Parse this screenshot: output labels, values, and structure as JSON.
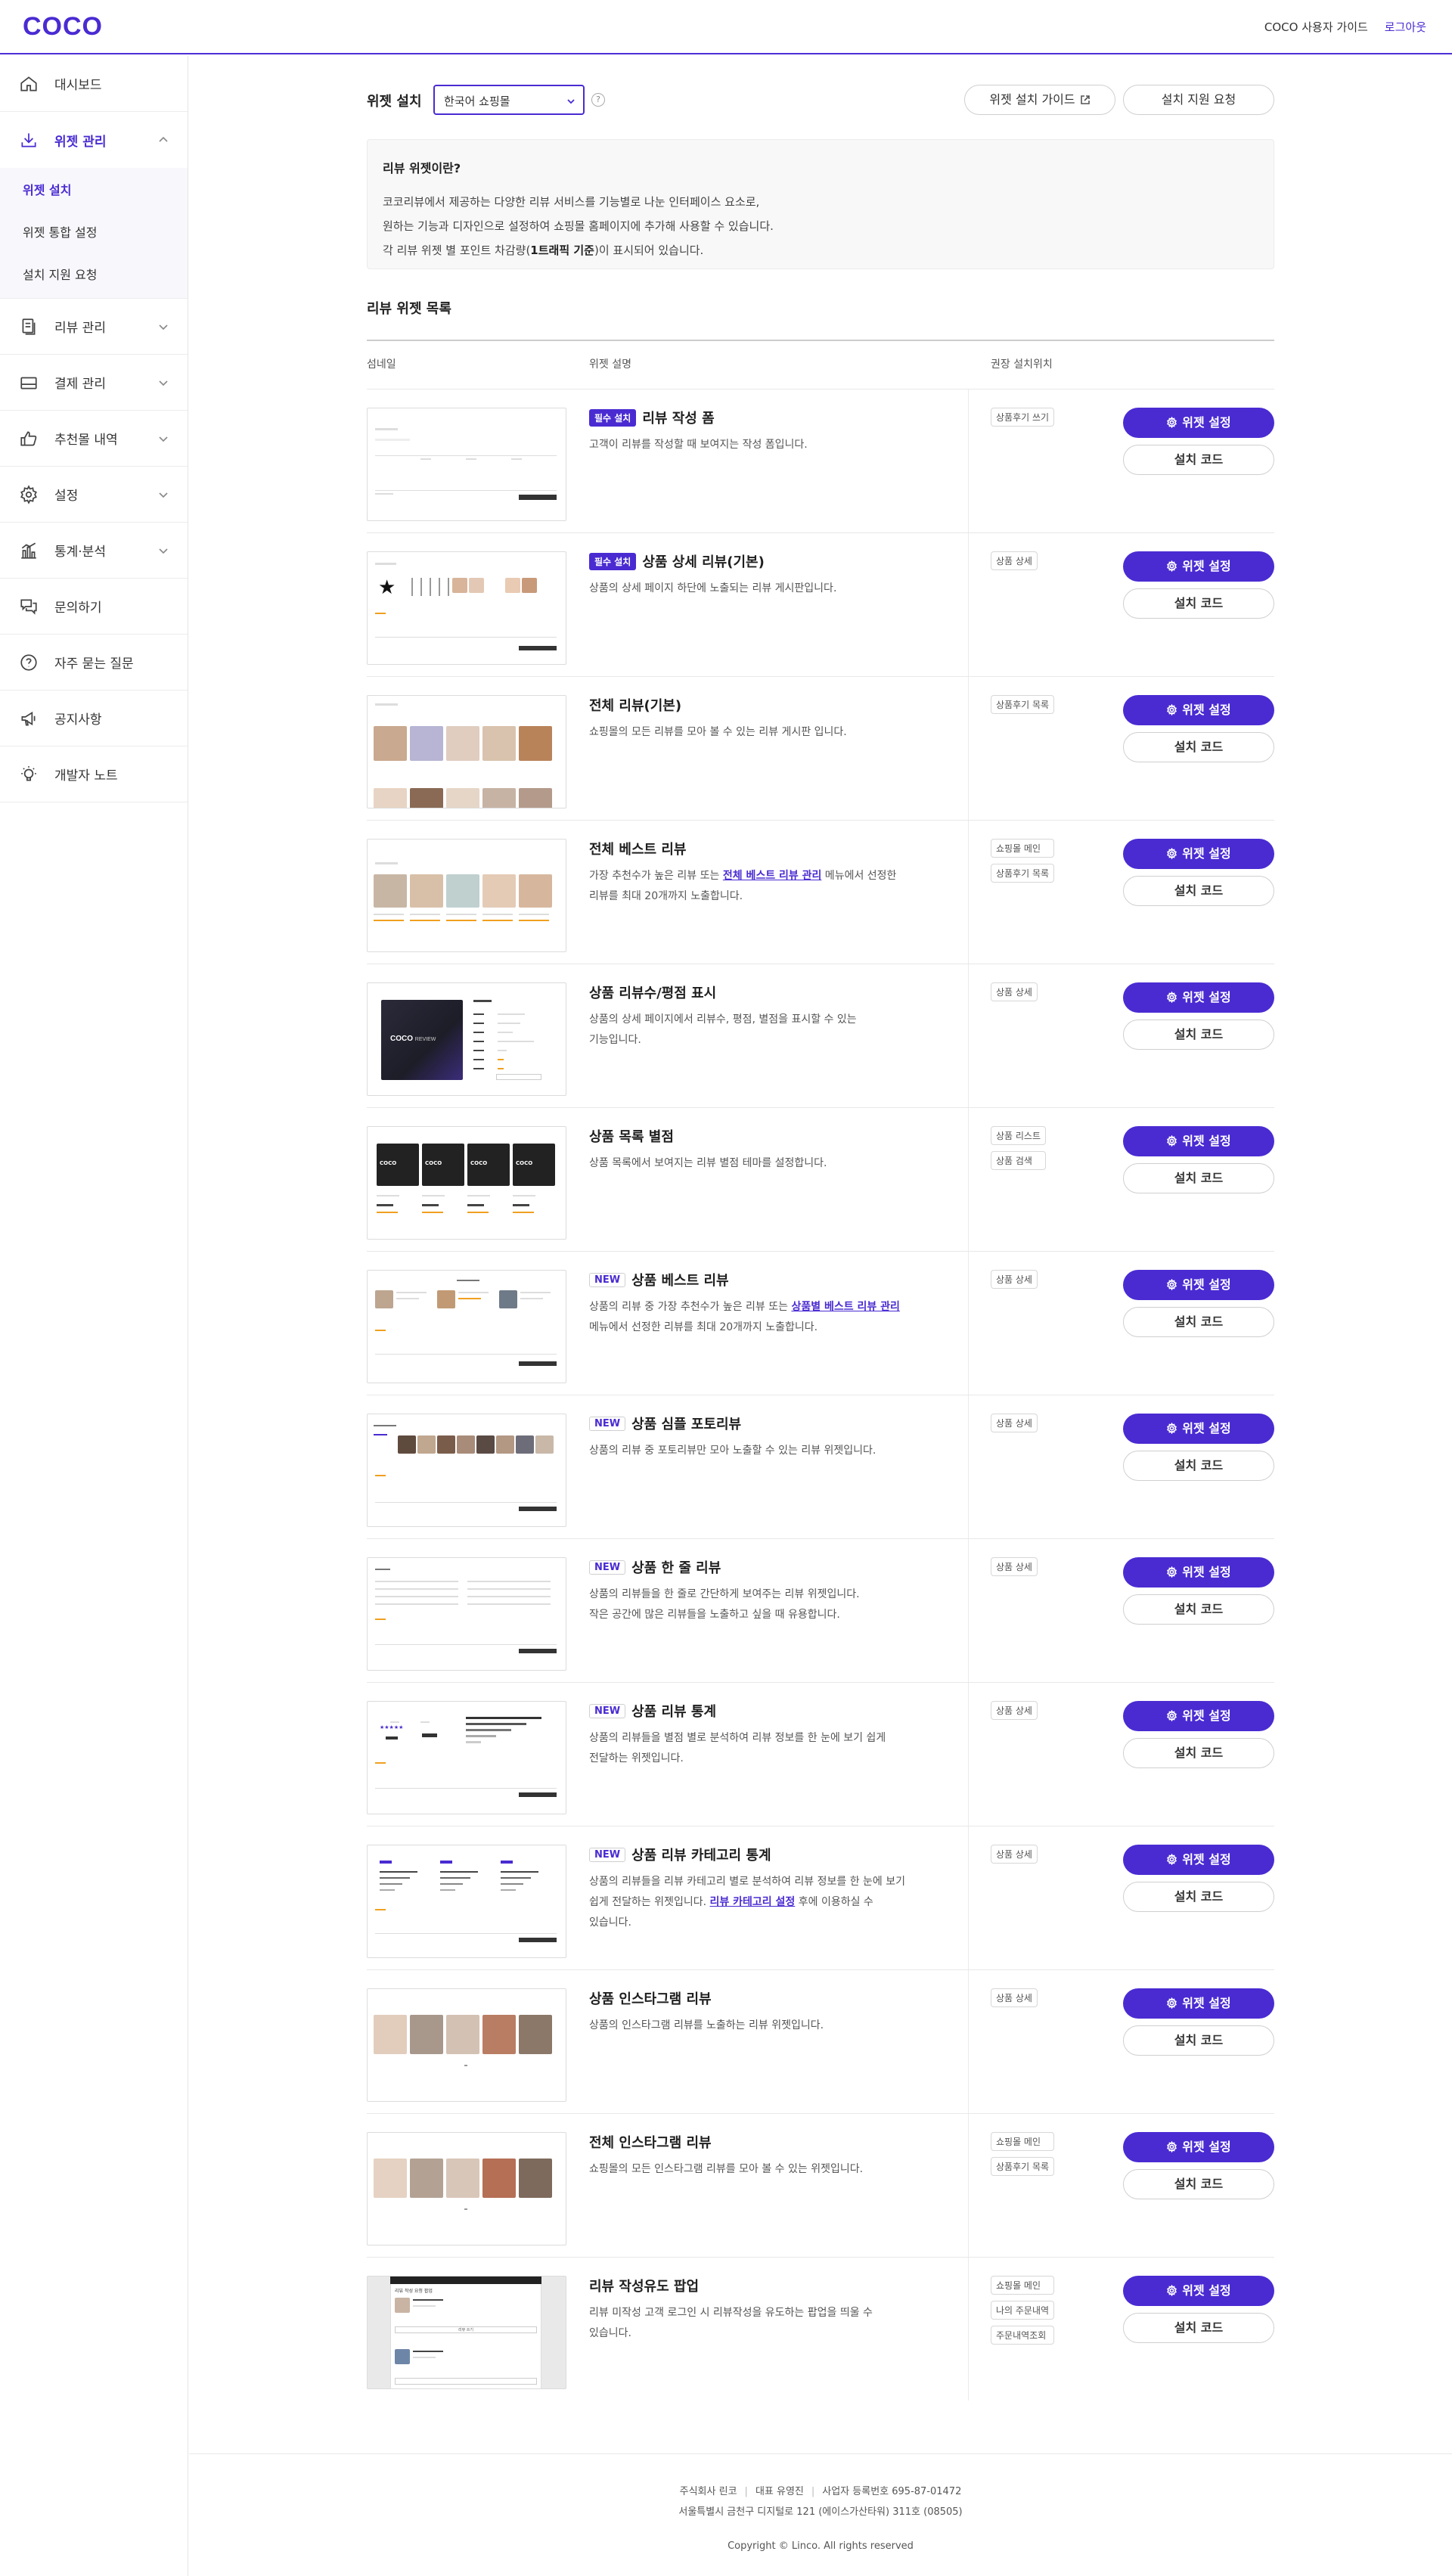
{
  "header": {
    "logo": "COCO",
    "guide_link": "COCO 사용자 가이드",
    "logout_link": "로그아웃"
  },
  "sidebar": {
    "items": [
      {
        "label": "대시보드",
        "icon": "home-icon"
      },
      {
        "label": "위젯 관리",
        "icon": "download-icon",
        "active": true
      },
      {
        "label": "리뷰 관리",
        "icon": "document-icon"
      },
      {
        "label": "결제 관리",
        "icon": "card-icon"
      },
      {
        "label": "추천몰 내역",
        "icon": "thumbs-up-icon"
      },
      {
        "label": "설정",
        "icon": "gear-icon"
      },
      {
        "label": "통계·분석",
        "icon": "chart-icon"
      },
      {
        "label": "문의하기",
        "icon": "chat-icon"
      },
      {
        "label": "자주 묻는 질문",
        "icon": "question-icon"
      },
      {
        "label": "공지사항",
        "icon": "megaphone-icon"
      },
      {
        "label": "개발자 노트",
        "icon": "bulb-icon"
      }
    ],
    "submenu": [
      "위젯 설치",
      "위젯 통합 설정",
      "설치 지원 요청"
    ]
  },
  "topbar": {
    "label": "위젯 설치",
    "select_value": "한국어 쇼핑몰",
    "help": "?",
    "guide_button": "위젯 설치 가이드",
    "support_button": "설치 지원 요청"
  },
  "info": {
    "title": "리뷰 위젯이란?",
    "line1": "코코리뷰에서 제공하는 다양한 리뷰 서비스를 기능별로 나눈 인터페이스 요소로,",
    "line2": "원하는 기능과 디자인으로 설정하여 쇼핑몰 홈페이지에 추가해 사용할 수 있습니다.",
    "line3_pre": "각 리뷰 위젯 별 포인트 차감량(",
    "line3_bold": "1트래픽 기준",
    "line3_post": ")이 표시되어 있습니다."
  },
  "list": {
    "title": "리뷰 위젯 목록",
    "col_thumb": "섬네일",
    "col_desc": "위젯 설명",
    "col_loc": "권장 설치위치",
    "setting_button": "위젯 설정",
    "code_button": "설치 코드",
    "badge_required": "필수 설치",
    "badge_new": "NEW"
  },
  "widgets": [
    {
      "title": "리뷰 작성 폼",
      "badge": "required",
      "desc": [
        "고객이 리뷰를 작성할 때 보여지는 작성 폼입니다."
      ],
      "locations": [
        "상품후기 쓰기"
      ]
    },
    {
      "title": "상품 상세 리뷰(기본)",
      "badge": "required",
      "desc": [
        "상품의 상세 페이지 하단에 노출되는 리뷰 게시판입니다."
      ],
      "locations": [
        "상품 상세"
      ]
    },
    {
      "title": "전체 리뷰(기본)",
      "badge": "",
      "desc": [
        "쇼핑몰의 모든 리뷰를 모아 볼 수 있는 리뷰 게시판 입니다."
      ],
      "locations": [
        "상품후기 목록"
      ]
    },
    {
      "title": "전체 베스트 리뷰",
      "badge": "",
      "desc_pre": "가장 추천수가 높은 리뷰 또는 ",
      "desc_link": "전체 베스트 리뷰 관리",
      "desc_post": " 메뉴에서 선정한",
      "desc2": "리뷰를 최대 20개까지 노출합니다.",
      "locations": [
        "쇼핑몰 메인",
        "상품후기 목록"
      ]
    },
    {
      "title": "상품 리뷰수/평점 표시",
      "badge": "",
      "desc": [
        "상품의 상세 페이지에서 리뷰수, 평점, 별점을 표시할 수 있는",
        "기능입니다."
      ],
      "locations": [
        "상품 상세"
      ]
    },
    {
      "title": "상품 목록 별점",
      "badge": "",
      "desc": [
        "상품 목록에서 보여지는 리뷰 별점 테마를 설정합니다."
      ],
      "locations": [
        "상품 리스트",
        "상품 검색"
      ]
    },
    {
      "title": "상품 베스트 리뷰",
      "badge": "new",
      "desc_pre": "상품의 리뷰 중 가장 추천수가 높은 리뷰 또는 ",
      "desc_link": "상품별 베스트 리뷰 관리",
      "desc_post": "",
      "desc2": "메뉴에서 선정한 리뷰를 최대 20개까지 노출합니다.",
      "locations": [
        "상품 상세"
      ]
    },
    {
      "title": "상품 심플 포토리뷰",
      "badge": "new",
      "desc": [
        "상품의 리뷰 중 포토리뷰만 모아 노출할 수 있는 리뷰 위젯입니다."
      ],
      "locations": [
        "상품 상세"
      ]
    },
    {
      "title": "상품 한 줄 리뷰",
      "badge": "new",
      "desc": [
        "상품의 리뷰들을 한 줄로 간단하게 보여주는 리뷰 위젯입니다.",
        "작은 공간에 많은 리뷰들을 노출하고 싶을 때 유용합니다."
      ],
      "locations": [
        "상품 상세"
      ]
    },
    {
      "title": "상품 리뷰 통계",
      "badge": "new",
      "desc": [
        "상품의 리뷰들을 별점 별로 분석하여 리뷰 정보를 한 눈에 보기 쉽게",
        "전달하는 위젯입니다."
      ],
      "locations": [
        "상품 상세"
      ]
    },
    {
      "title": "상품 리뷰 카테고리 통계",
      "badge": "new",
      "desc_a": "상품의 리뷰들을 리뷰 카테고리 별로 분석하여 리뷰 정보를 한 눈에 보기",
      "desc_b_pre": "쉽게 전달하는 위젯입니다. ",
      "desc_link": "리뷰 카테고리 설정",
      "desc_b_post": " 후에 이용하실 수",
      "desc_c": "있습니다.",
      "locations": [
        "상품 상세"
      ]
    },
    {
      "title": "상품 인스타그램 리뷰",
      "badge": "",
      "desc": [
        "상품의 인스타그램 리뷰를 노출하는 리뷰 위젯입니다."
      ],
      "locations": [
        "상품 상세"
      ]
    },
    {
      "title": "전체 인스타그램 리뷰",
      "badge": "",
      "desc": [
        "쇼핑몰의 모든 인스타그램 리뷰를 모아 볼 수 있는 위젯입니다."
      ],
      "locations": [
        "쇼핑몰 메인",
        "상품후기 목록"
      ]
    },
    {
      "title": "리뷰 작성유도 팝업",
      "badge": "",
      "desc": [
        "리뷰 미작성 고객 로그인 시 리뷰작성을 유도하는 팝업을 띄울 수",
        "있습니다."
      ],
      "locations": [
        "쇼핑몰 메인",
        "나의 주문내역",
        "주문내역조회"
      ]
    }
  ],
  "thumb_text": {
    "brand": "COCO",
    "brand_suffix": "REVIEW",
    "popup_title": "리뷰 작성 요청 팝업",
    "popup_button": "리뷰 쓰기"
  },
  "footer": {
    "company": "주식회사 린코",
    "ceo": "대표 유영진",
    "biz_no": "사업자 등록번호 695-87-01472",
    "address": "서울특별시 금천구 디지털로 121 (에이스가산타워) 311호 (08505)",
    "copyright": "Copyright © Linco. All rights reserved"
  },
  "colors": {
    "accent": "#4a2bd2",
    "border": "#e8e8e8"
  }
}
